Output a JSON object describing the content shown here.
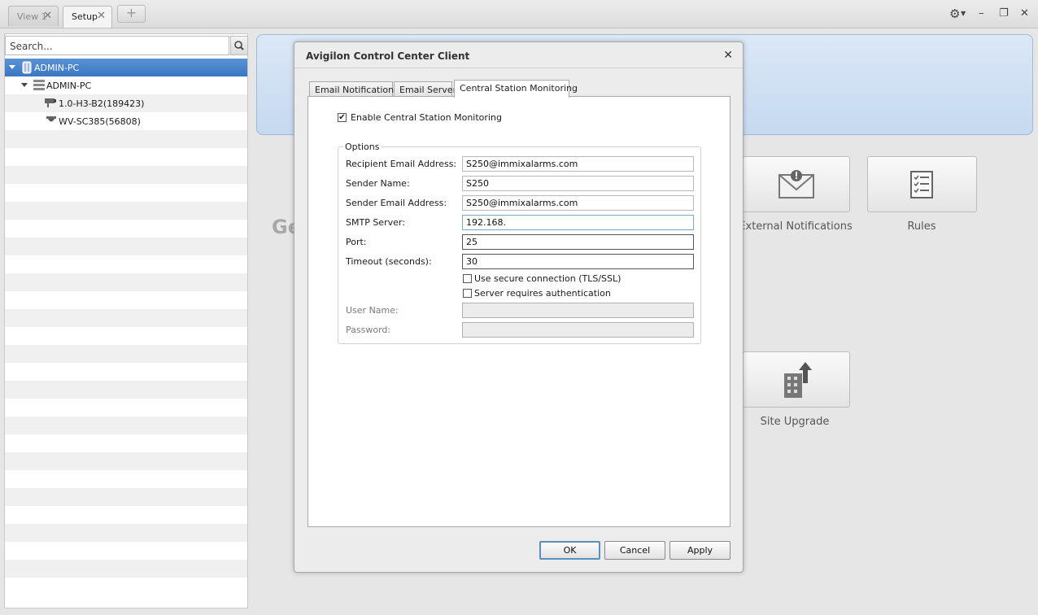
{
  "tabs": [
    {
      "label": "View 1"
    },
    {
      "label": "Setup"
    }
  ],
  "tab_add_label": "+",
  "window_controls": {
    "settings_icon": "gear-icon",
    "minimize": "–",
    "restore": "❐",
    "close": "✕"
  },
  "search": {
    "placeholder": "Search..."
  },
  "tree": [
    {
      "label": "ADMIN-PC",
      "icon": "site-icon"
    },
    {
      "label": "ADMIN-PC",
      "icon": "server-icon"
    },
    {
      "label": "1.0-H3-B2(189423)",
      "icon": "bullet-camera-icon"
    },
    {
      "label": "WV-SC385(56808)",
      "icon": "dome-camera-icon"
    }
  ],
  "main": {
    "partial_heading": "Ge",
    "tiles": [
      {
        "label": "External Notifications",
        "icon": "envelope-alert-icon"
      },
      {
        "label": "Rules",
        "icon": "checklist-icon"
      },
      {
        "label": "Site Upgrade",
        "icon": "building-upgrade-icon"
      }
    ]
  },
  "dialog": {
    "title": "Avigilon Control Center Client",
    "tabs": [
      "Email Notifications",
      "Email Server",
      "Central Station Monitoring"
    ],
    "active_tab": "Central Station Monitoring",
    "enable_label": "Enable Central Station Monitoring",
    "enable_checked": true,
    "options_title": "Options",
    "fields": {
      "recipient_label": "Recipient Email Address:",
      "recipient_value": "S250@immixalarms.com",
      "sender_name_label": "Sender Name:",
      "sender_name_value": "S250",
      "sender_email_label": "Sender Email Address:",
      "sender_email_value": "S250@immixalarms.com",
      "smtp_label": "SMTP Server:",
      "smtp_value": "192.168.",
      "port_label": "Port:",
      "port_value": "25",
      "timeout_label": "Timeout (seconds):",
      "timeout_value": "30",
      "tls_label": "Use secure connection (TLS/SSL)",
      "tls_checked": false,
      "auth_label": "Server requires authentication",
      "auth_checked": false,
      "username_label": "User Name:",
      "username_value": "",
      "password_label": "Password:",
      "password_value": ""
    },
    "buttons": {
      "ok": "OK",
      "cancel": "Cancel",
      "apply": "Apply"
    }
  }
}
